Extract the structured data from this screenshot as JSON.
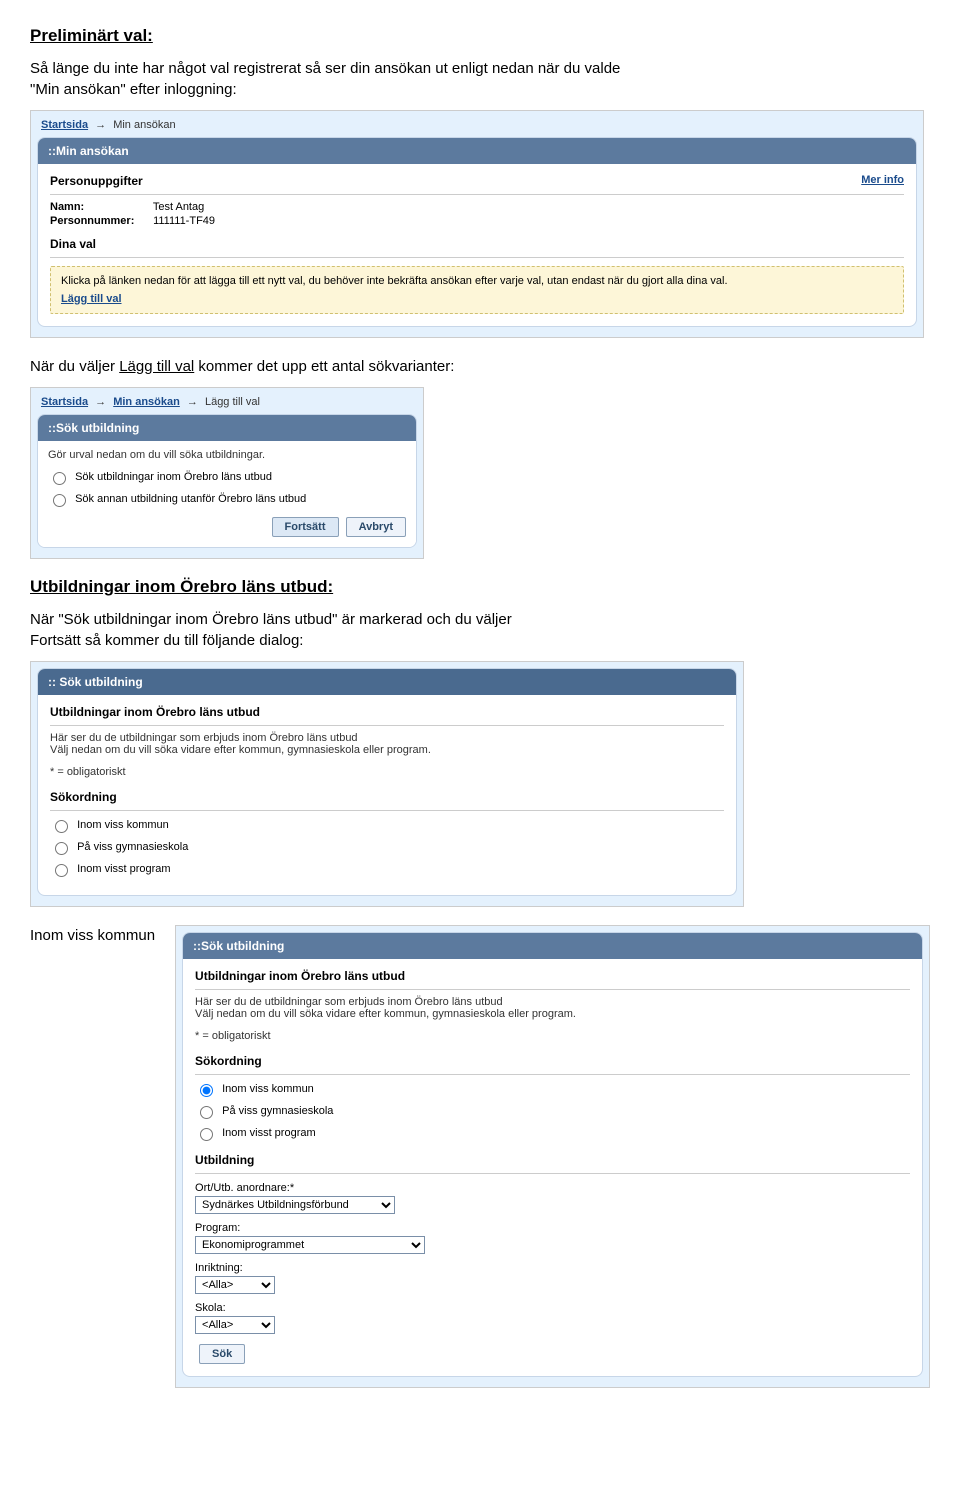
{
  "doc": {
    "h_preliminart": "Preliminärt val:",
    "p_intro1a": "Så länge du inte har något val registrerat så ser din ansökan ut enligt nedan när du valde ",
    "p_intro1b": "\"Min ansökan\" efter inloggning:",
    "p_nar_du_valjer_pre": "När du väljer ",
    "p_lagg_till_val": "Lägg till val",
    "p_nar_du_valjer_post": " kommer det upp ett antal sökvarianter:",
    "h_utb_orebro": "Utbildningar inom Örebro läns utbud:",
    "p_utb_pre": "När \"Sök utbildningar inom Örebro läns utbud\" är markerad och du väljer ",
    "p_fortsatt": "Fortsätt",
    "p_utb_post": " så kommer du till följande dialog:",
    "label_inom_viss_kommun": "Inom viss kommun"
  },
  "shot1": {
    "bc_start": "Startsida",
    "bc_sep": "→",
    "bc_cur": "Min ansökan",
    "panel_title": "::Min ansökan",
    "personuppgifter": "Personuppgifter",
    "mer_info": "Mer info",
    "namn_k": "Namn:",
    "namn_v": "Test Antag",
    "pnr_k": "Personnummer:",
    "pnr_v": "111111-TF49",
    "dina_val": "Dina val",
    "yellow_text": "Klicka på länken nedan för att lägga till ett nytt val, du behöver inte bekräfta ansökan efter varje val, utan endast när du gjort alla dina val.",
    "lagg_till_val": "Lägg till val"
  },
  "shot2": {
    "bc_start": "Startsida",
    "bc_min": "Min ansökan",
    "bc_sep": "→",
    "bc_cur": "Lägg till val",
    "panel_title": "::Sök utbildning",
    "intro": "Gör urval nedan om du vill söka utbildningar.",
    "opt1": "Sök utbildningar inom Örebro läns utbud",
    "opt2": "Sök annan utbildning utanför Örebro läns utbud",
    "btn_fortsatt": "Fortsätt",
    "btn_avbryt": "Avbryt"
  },
  "shot3": {
    "panel_title": ":: Sök utbildning",
    "title": "Utbildningar inom Örebro läns utbud",
    "desc1": "Här ser du de utbildningar som erbjuds inom Örebro läns utbud",
    "desc2": "Välj nedan om du vill söka vidare efter kommun, gymnasieskola eller program.",
    "oblig": "* = obligatoriskt",
    "sokordning": "Sökordning",
    "opt_kommun": "Inom viss kommun",
    "opt_gymn": "På viss gymnasieskola",
    "opt_prog": "Inom visst program"
  },
  "shot4": {
    "panel_title": "::Sök utbildning",
    "title": "Utbildningar inom Örebro läns utbud",
    "desc1": "Här ser du de utbildningar som erbjuds inom Örebro läns utbud",
    "desc2": "Välj nedan om du vill söka vidare efter kommun, gymnasieskola eller program.",
    "oblig": "* = obligatoriskt",
    "sokordning": "Sökordning",
    "opt_kommun": "Inom viss kommun",
    "opt_gymn": "På viss gymnasieskola",
    "opt_prog": "Inom visst program",
    "utbildning": "Utbildning",
    "f_ort_label": "Ort/Utb. anordnare:*",
    "f_ort_value": "Sydnärkes Utbildningsförbund",
    "f_program_label": "Program:",
    "f_program_value": "Ekonomiprogrammet",
    "f_inrikt_label": "Inriktning:",
    "f_inrikt_value": "<Alla>",
    "f_skola_label": "Skola:",
    "f_skola_value": "<Alla>",
    "btn_sok": "Sök"
  }
}
